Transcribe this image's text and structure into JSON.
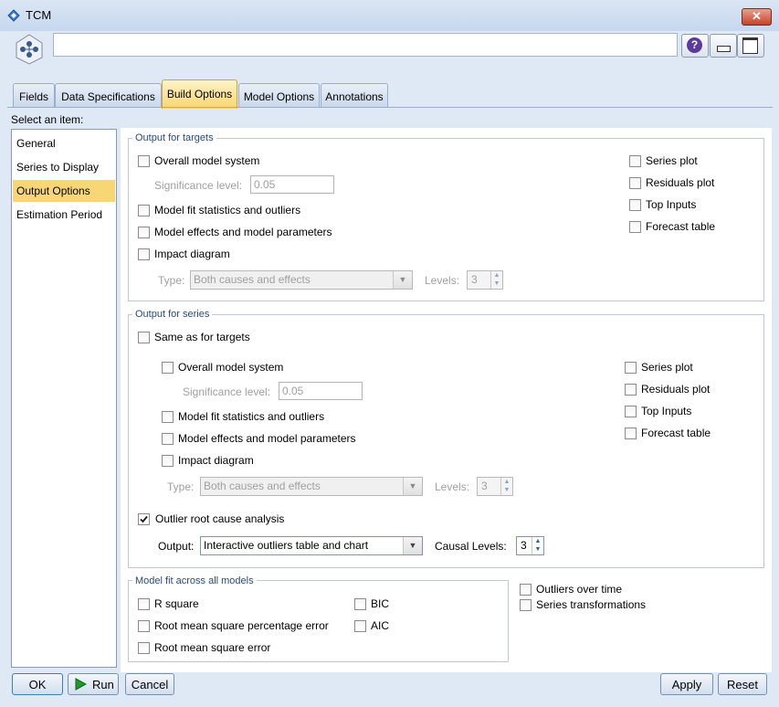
{
  "window": {
    "title": "TCM",
    "close_glyph": "✕"
  },
  "node": {
    "name_value": "",
    "icon": "tcm-node-icon"
  },
  "header_buttons": {
    "help_glyph": "?",
    "minimize_glyph": "▭",
    "maximize_glyph": "□"
  },
  "tabs": [
    "Fields",
    "Data Specifications",
    "Build Options",
    "Model Options",
    "Annotations"
  ],
  "active_tab": "Build Options",
  "sidebar": {
    "label": "Select an item:",
    "items": [
      "General",
      "Series to Display",
      "Output Options",
      "Estimation Period"
    ],
    "selected": "Output Options"
  },
  "targets": {
    "legend": "Output for targets",
    "overall_model_system": "Overall model system",
    "significance_label": "Significance level:",
    "significance_value": "0.05",
    "model_fit": "Model fit statistics and outliers",
    "model_effects": "Model effects and model parameters",
    "impact_diagram": "Impact diagram",
    "type_label": "Type:",
    "type_value": "Both causes and effects",
    "levels_label": "Levels:",
    "levels_value": "3",
    "series_plot": "Series plot",
    "residuals_plot": "Residuals plot",
    "top_inputs": "Top Inputs",
    "forecast_table": "Forecast table"
  },
  "series": {
    "legend": "Output for series",
    "same_as_targets": "Same as for targets",
    "overall_model_system": "Overall model system",
    "significance_label": "Significance level:",
    "significance_value": "0.05",
    "model_fit": "Model fit statistics and outliers",
    "model_effects": "Model effects and model parameters",
    "impact_diagram": "Impact diagram",
    "type_label": "Type:",
    "type_value": "Both causes and effects",
    "levels_label": "Levels:",
    "levels_value": "3",
    "series_plot": "Series plot",
    "residuals_plot": "Residuals plot",
    "top_inputs": "Top Inputs",
    "forecast_table": "Forecast table",
    "outlier_root_cause": "Outlier root cause analysis",
    "outlier_checked": true,
    "output_label": "Output:",
    "output_value": "Interactive outliers table and chart",
    "causal_levels_label": "Causal Levels:",
    "causal_levels_value": "3"
  },
  "model_fit": {
    "legend": "Model fit across all models",
    "r_square": "R square",
    "rmspe": "Root mean square percentage error",
    "rmse": "Root mean square error",
    "bic": "BIC",
    "aic": "AIC"
  },
  "extras": {
    "outliers_over_time": "Outliers over time",
    "series_transformations": "Series transformations"
  },
  "buttons": {
    "ok": "OK",
    "run": "Run",
    "cancel": "Cancel",
    "apply": "Apply",
    "reset": "Reset"
  },
  "colors": {
    "active_tab": "#f7d66f",
    "selected_item": "#f7d775",
    "legend_text": "#2b4a7a",
    "run_icon": "#1f9a2a"
  }
}
